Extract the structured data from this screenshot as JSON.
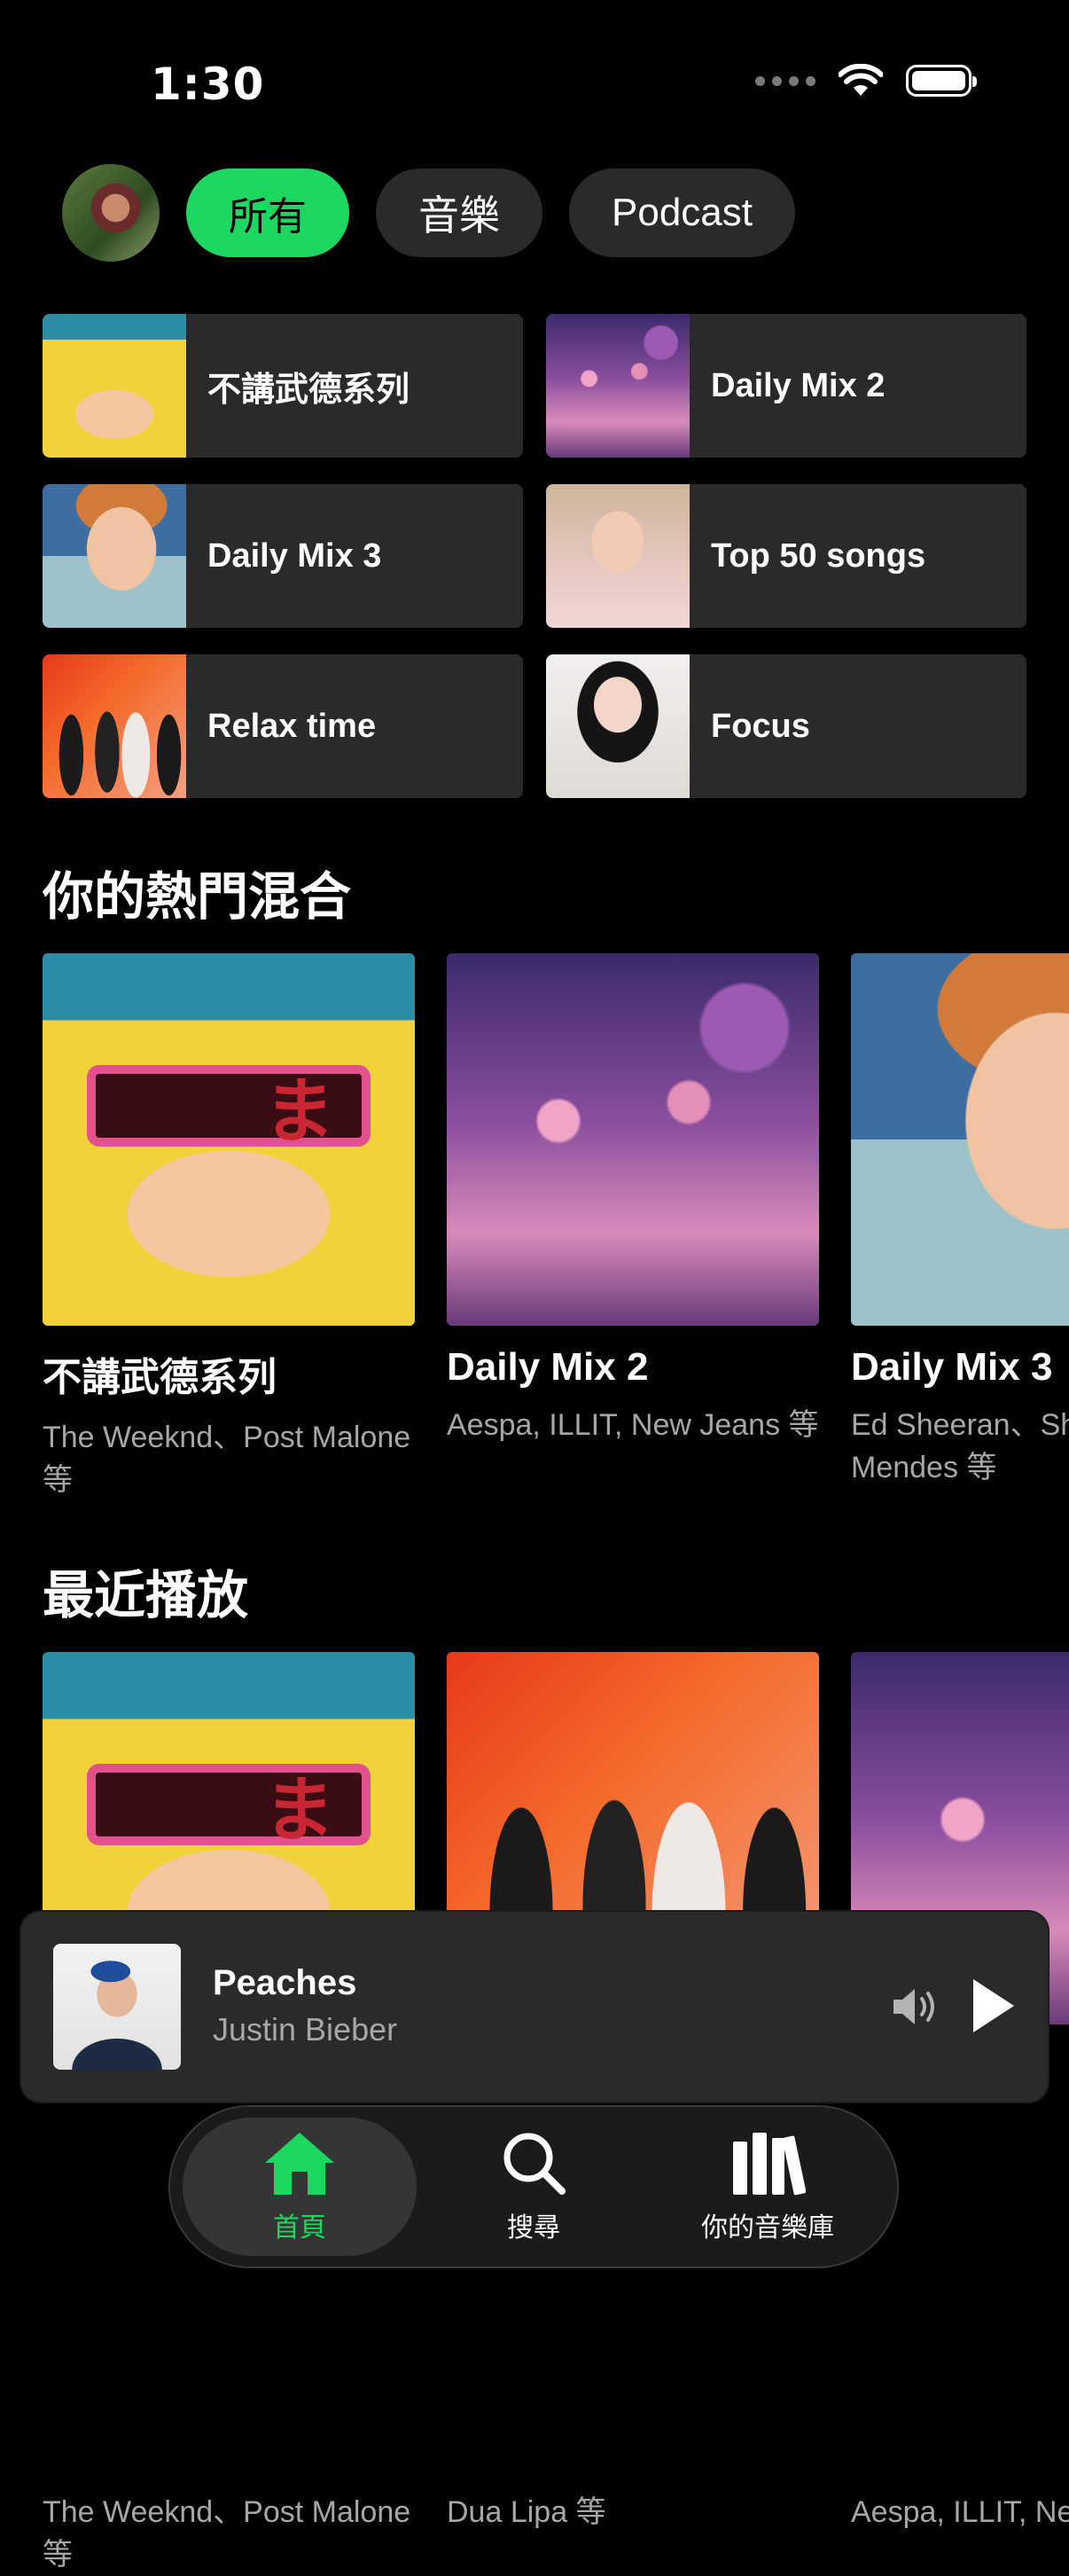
{
  "status": {
    "time": "1:30"
  },
  "filters": {
    "chips": [
      "所有",
      "音樂",
      "Podcast"
    ],
    "active": "所有"
  },
  "quick_picks": [
    {
      "label": "不講武德系列"
    },
    {
      "label": "Daily Mix 2"
    },
    {
      "label": "Daily Mix 3"
    },
    {
      "label": "Top 50 songs"
    },
    {
      "label": "Relax time"
    },
    {
      "label": "Focus"
    }
  ],
  "top_mixes": {
    "title": "你的熱門混合",
    "cards": [
      {
        "title": "不講武德系列",
        "subtitle": "The Weeknd、Post Malone 等"
      },
      {
        "title": "Daily Mix 2",
        "subtitle": "Aespa, ILLIT, New Jeans 等"
      },
      {
        "title": "Daily Mix 3",
        "subtitle": "Ed Sheeran、Shawn Mendes 等"
      }
    ]
  },
  "recent": {
    "title": "最近播放",
    "cards": [
      {
        "subtitle": "The Weeknd、Post Malone 等"
      },
      {
        "subtitle": "Dua Lipa 等"
      },
      {
        "subtitle": "Aespa, ILLIT, New Jeans 等"
      }
    ]
  },
  "player": {
    "song": "Peaches",
    "artist": "Justin Bieber"
  },
  "tabs": [
    {
      "label": "首頁",
      "icon": "home-icon",
      "active": true
    },
    {
      "label": "搜尋",
      "icon": "search-icon"
    },
    {
      "label": "你的音樂庫",
      "icon": "library-icon"
    }
  ],
  "colors": {
    "accent": "#1ed760",
    "surface": "#2a2a2a",
    "muted": "#a7a7a7"
  }
}
